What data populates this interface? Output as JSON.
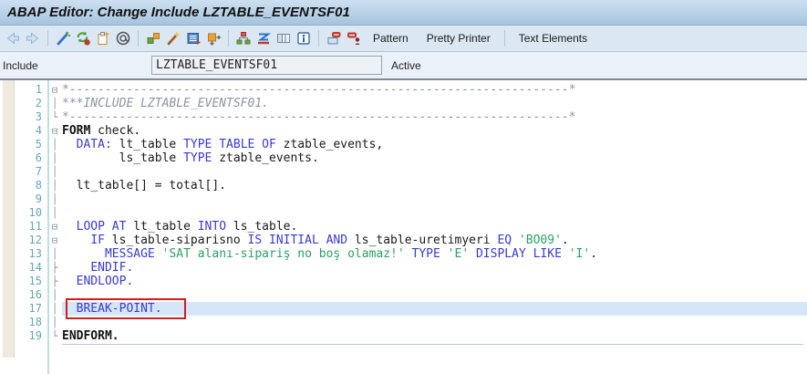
{
  "title_bar": {
    "title": "ABAP Editor: Change Include LZTABLE_EVENTSF01"
  },
  "toolbar": {
    "icon_names": [
      "back-icon",
      "forward-icon",
      "syntax-check-icon",
      "activate-icon",
      "copy-icon",
      "where-used-icon",
      "insert-statement-icon",
      "pattern-wand-icon",
      "object-list-icon",
      "navigate-icon",
      "hierarchy-icon",
      "sort-icon",
      "table-view-icon",
      "info-icon",
      "modification-assistant-icon",
      "improvement-note-icon"
    ],
    "buttons": {
      "pattern": "Pattern",
      "pretty_printer": "Pretty Printer",
      "text_elements": "Text Elements"
    }
  },
  "include_bar": {
    "label": "Include",
    "value": "LZTABLE_EVENTSF01",
    "status": "Active"
  },
  "editor": {
    "highlight_line": 17,
    "colors": {
      "keyword": "#3939d9",
      "string": "#28a263",
      "comment": "#8a95a5",
      "line_number": "#62a8b8",
      "highlight_row": "#d6e6f6",
      "breakpoint_box": "#cc1f1f"
    },
    "lines": [
      {
        "n": 1,
        "fold": "⊟",
        "seg": [
          {
            "c": "cmt",
            "t": "*----------------------------------------------------------------------*"
          }
        ]
      },
      {
        "n": 2,
        "fold": "│",
        "seg": [
          {
            "c": "cmt",
            "t": "***INCLUDE LZTABLE_EVENTSF01."
          }
        ]
      },
      {
        "n": 3,
        "fold": "└",
        "seg": [
          {
            "c": "cmt",
            "t": "*----------------------------------------------------------------------*"
          }
        ]
      },
      {
        "n": 4,
        "fold": "⊟",
        "seg": [
          {
            "c": "frm",
            "t": "FORM"
          },
          {
            "c": "id",
            "t": " check."
          }
        ]
      },
      {
        "n": 5,
        "fold": "│",
        "seg": [
          {
            "c": "id",
            "t": "  "
          },
          {
            "c": "kw",
            "t": "DATA:"
          },
          {
            "c": "id",
            "t": " lt_table "
          },
          {
            "c": "kw",
            "t": "TYPE TABLE OF"
          },
          {
            "c": "id",
            "t": " ztable_events,"
          }
        ]
      },
      {
        "n": 6,
        "fold": "│",
        "seg": [
          {
            "c": "id",
            "t": "        ls_table "
          },
          {
            "c": "kw",
            "t": "TYPE"
          },
          {
            "c": "id",
            "t": " ztable_events."
          }
        ]
      },
      {
        "n": 7,
        "fold": "│",
        "seg": []
      },
      {
        "n": 8,
        "fold": "│",
        "seg": [
          {
            "c": "id",
            "t": "  lt_table[] = total[]."
          }
        ]
      },
      {
        "n": 9,
        "fold": "│",
        "seg": []
      },
      {
        "n": 10,
        "fold": "│",
        "seg": []
      },
      {
        "n": 11,
        "fold": "⊟",
        "seg": [
          {
            "c": "id",
            "t": "  "
          },
          {
            "c": "kw",
            "t": "LOOP AT"
          },
          {
            "c": "id",
            "t": " lt_table "
          },
          {
            "c": "kw",
            "t": "INTO"
          },
          {
            "c": "id",
            "t": " ls_table."
          }
        ]
      },
      {
        "n": 12,
        "fold": "⊟",
        "seg": [
          {
            "c": "id",
            "t": "    "
          },
          {
            "c": "kw",
            "t": "IF"
          },
          {
            "c": "id",
            "t": " ls_table-siparisno "
          },
          {
            "c": "kw",
            "t": "IS INITIAL AND"
          },
          {
            "c": "id",
            "t": " ls_table-uretimyeri "
          },
          {
            "c": "kw",
            "t": "EQ"
          },
          {
            "c": "id",
            "t": " "
          },
          {
            "c": "str",
            "t": "'BO09'"
          },
          {
            "c": "id",
            "t": "."
          }
        ]
      },
      {
        "n": 13,
        "fold": "│",
        "seg": [
          {
            "c": "id",
            "t": "      "
          },
          {
            "c": "kw",
            "t": "MESSAGE"
          },
          {
            "c": "id",
            "t": " "
          },
          {
            "c": "str",
            "t": "'SAT alanı-sipariş no boş olamaz!'"
          },
          {
            "c": "id",
            "t": " "
          },
          {
            "c": "kw",
            "t": "TYPE"
          },
          {
            "c": "id",
            "t": " "
          },
          {
            "c": "str",
            "t": "'E'"
          },
          {
            "c": "id",
            "t": " "
          },
          {
            "c": "kw",
            "t": "DISPLAY LIKE"
          },
          {
            "c": "id",
            "t": " "
          },
          {
            "c": "str",
            "t": "'I'"
          },
          {
            "c": "id",
            "t": "."
          }
        ]
      },
      {
        "n": 14,
        "fold": "├",
        "seg": [
          {
            "c": "id",
            "t": "    "
          },
          {
            "c": "kw",
            "t": "ENDIF."
          }
        ]
      },
      {
        "n": 15,
        "fold": "├",
        "seg": [
          {
            "c": "id",
            "t": "  "
          },
          {
            "c": "kw",
            "t": "ENDLOOP."
          }
        ]
      },
      {
        "n": 16,
        "fold": "│",
        "seg": []
      },
      {
        "n": 17,
        "fold": "│",
        "seg": [
          {
            "c": "id",
            "t": "  "
          },
          {
            "c": "kw",
            "t": "BREAK-POINT."
          }
        ]
      },
      {
        "n": 18,
        "fold": "│",
        "seg": []
      },
      {
        "n": 19,
        "fold": "└",
        "seg": [
          {
            "c": "frm",
            "t": "ENDFORM."
          }
        ]
      }
    ]
  }
}
